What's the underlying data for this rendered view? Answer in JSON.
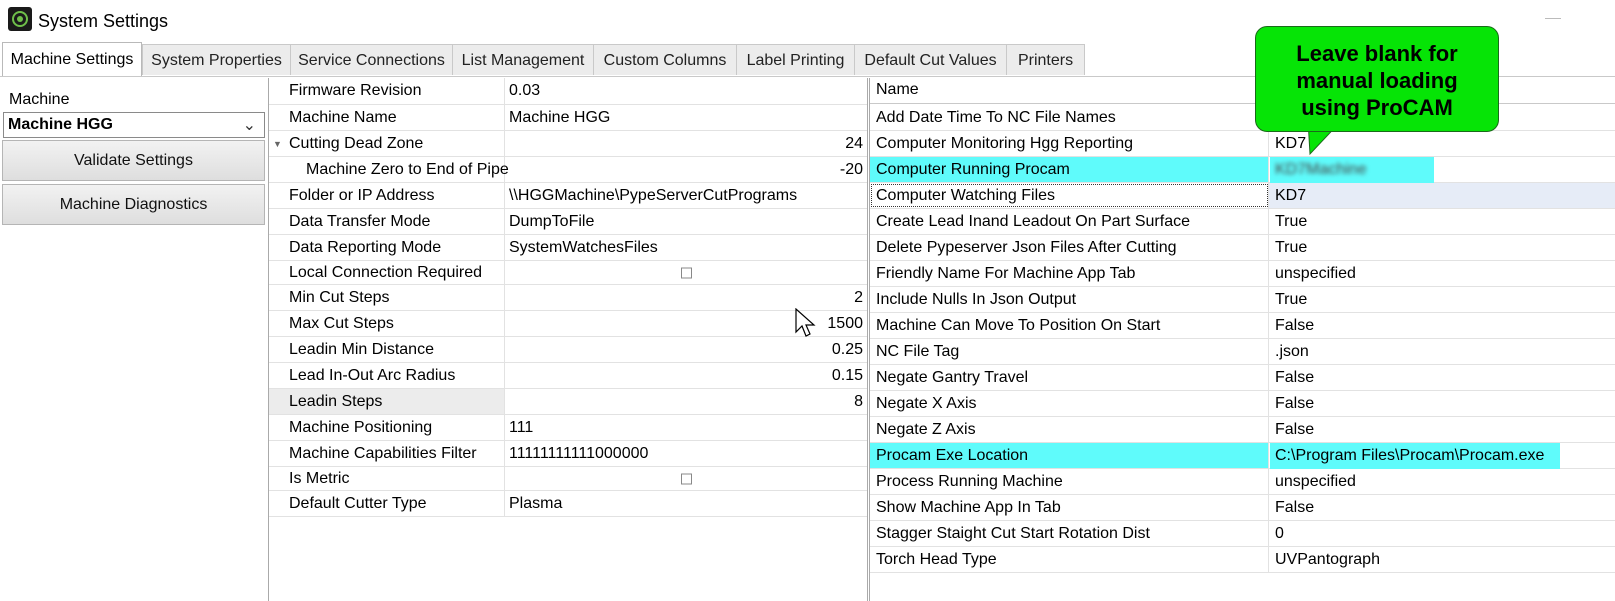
{
  "window": {
    "title": "System Settings"
  },
  "tabs": [
    {
      "label": "Machine Settings",
      "active": true
    },
    {
      "label": "System Properties"
    },
    {
      "label": "Service Connections"
    },
    {
      "label": "List Management"
    },
    {
      "label": "Custom Columns"
    },
    {
      "label": "Label Printing"
    },
    {
      "label": "Default Cut Values"
    },
    {
      "label": "Printers"
    }
  ],
  "left_panel": {
    "machine_label": "Machine",
    "machine_selected": "Machine HGG",
    "validate_button": "Validate Settings",
    "diagnostics_button": "Machine Diagnostics"
  },
  "machine_properties": [
    {
      "label": "Firmware Revision",
      "value": "0.03"
    },
    {
      "label": "Machine Name",
      "value": "Machine HGG"
    },
    {
      "label": "Cutting Dead Zone",
      "value": "24"
    },
    {
      "label": "Machine Zero to End of Pipe",
      "value": "-20"
    },
    {
      "label": "Folder or IP Address",
      "value": "\\\\HGGMachine\\PypeServerCutPrograms"
    },
    {
      "label": "Data Transfer Mode",
      "value": "DumpToFile"
    },
    {
      "label": "Data Reporting Mode",
      "value": "SystemWatchesFiles"
    },
    {
      "label": "Local Connection Required",
      "value": false
    },
    {
      "label": "Min Cut Steps",
      "value": "2"
    },
    {
      "label": "Max Cut Steps",
      "value": "1500"
    },
    {
      "label": "Leadin Min Distance",
      "value": "0.25"
    },
    {
      "label": "Lead In-Out Arc Radius",
      "value": "0.15"
    },
    {
      "label": "Leadin Steps",
      "value": "8"
    },
    {
      "label": "Machine Positioning",
      "value": "111"
    },
    {
      "label": "Machine Capabilities Filter",
      "value": "11111111111000000"
    },
    {
      "label": "Is Metric",
      "value": false
    },
    {
      "label": "Default Cutter Type",
      "value": "Plasma"
    }
  ],
  "settings_grid": {
    "header_name": "Name",
    "rows": [
      {
        "name": "Add Date Time To NC File Names",
        "value": ""
      },
      {
        "name": "Computer Monitoring Hgg Reporting",
        "value": "KD7"
      },
      {
        "name": "Computer Running Procam",
        "value": "KD7Machine"
      },
      {
        "name": "Computer Watching Files",
        "value": "KD7"
      },
      {
        "name": "Create Lead Inand Leadout On Part Surface",
        "value": "True"
      },
      {
        "name": "Delete Pypeserver Json Files After Cutting",
        "value": "True"
      },
      {
        "name": "Friendly Name For Machine App Tab",
        "value": "unspecified"
      },
      {
        "name": "Include Nulls In Json Output",
        "value": "True"
      },
      {
        "name": "Machine Can Move To Position On Start",
        "value": "False"
      },
      {
        "name": "NC File Tag",
        "value": ".json"
      },
      {
        "name": "Negate Gantry Travel",
        "value": "False"
      },
      {
        "name": "Negate X Axis",
        "value": "False"
      },
      {
        "name": "Negate Z Axis",
        "value": "False"
      },
      {
        "name": "Procam Exe Location",
        "value": "C:\\Program Files\\Procam\\Procam.exe"
      },
      {
        "name": "Process Running Machine",
        "value": "unspecified"
      },
      {
        "name": "Show Machine App In Tab",
        "value": "False"
      },
      {
        "name": "Stagger Staight Cut Start Rotation Dist",
        "value": "0"
      },
      {
        "name": "Torch Head Type",
        "value": "UVPantograph"
      }
    ]
  },
  "callout": {
    "line1": "Leave blank for",
    "line2": "manual loading",
    "line3": "using ProCAM",
    "color": "#06e406"
  },
  "highlight_color": "#5ffbfb"
}
